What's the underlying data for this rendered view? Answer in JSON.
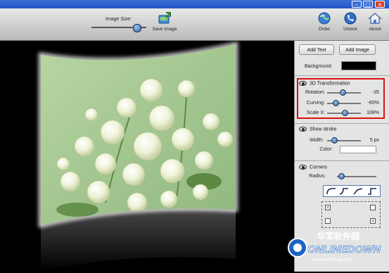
{
  "toolbar": {
    "image_size_label": "Image Size:",
    "image_size_value": 0.85,
    "save_label": "Save Image",
    "order_label": "Order",
    "unlock_label": "Unlock",
    "about_label": "About"
  },
  "panel": {
    "add_text": "Add Text",
    "add_image": "Add Image",
    "background_label": "Background:",
    "background_color": "#000000",
    "transform": {
      "title": "3D Transformation",
      "rows": [
        {
          "label": "Rotation:",
          "value": "-35",
          "level": 0.45
        },
        {
          "label": "Curving:",
          "value": "-65%",
          "level": 0.2
        },
        {
          "label": "Scale X:",
          "value": "108%",
          "level": 0.55
        }
      ]
    },
    "stroke": {
      "title": "Show stroke",
      "width_label": "Width:",
      "width_value": "5 px",
      "width_level": 0.15,
      "color_label": "Color:",
      "color": "#ffffff"
    },
    "corners": {
      "title": "Corners",
      "radius_label": "Radius:",
      "radius_level": 0.05
    }
  },
  "watermark": {
    "cn": "华军软件园",
    "brand": "ONLINEDOWN",
    "url": "www.newhua.com"
  }
}
